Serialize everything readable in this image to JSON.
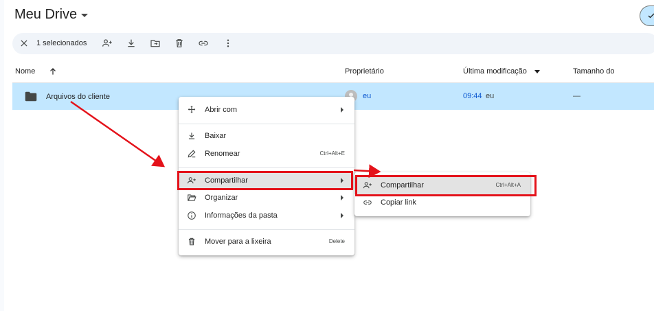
{
  "header": {
    "title": "Meu Drive"
  },
  "toolbar": {
    "selection_count": "1 selecionados"
  },
  "columns": {
    "name": "Nome",
    "owner": "Proprietário",
    "modified": "Última modificação",
    "size": "Tamanho do"
  },
  "file_row": {
    "name": "Arquivos do cliente",
    "owner": "eu",
    "modified": "09:44",
    "modified_by": "eu",
    "size": "—"
  },
  "context_menu": {
    "open_with": "Abrir com",
    "download": "Baixar",
    "rename": "Renomear",
    "rename_shortcut": "Ctrl+Alt+E",
    "share": "Compartilhar",
    "organize": "Organizar",
    "folder_info": "Informações da pasta",
    "trash": "Mover para a lixeira",
    "trash_shortcut": "Delete"
  },
  "share_submenu": {
    "share": "Compartilhar",
    "share_shortcut": "Ctrl+Alt+A",
    "copy_link": "Copiar link"
  },
  "colors": {
    "selected_row": "#c2e7ff",
    "toolbar_bg": "#f0f4f9",
    "annotation_red": "#e4121a",
    "hover_bg": "#e3e3e3",
    "link_blue": "#0b57d0"
  },
  "icons": [
    "close-icon",
    "add-person-icon",
    "download-icon",
    "move-folder-icon",
    "trash-icon",
    "link-icon",
    "more-vert-icon",
    "arrow-up-icon",
    "folder-icon",
    "open-with-icon",
    "rename-icon",
    "folder-open-icon",
    "info-icon",
    "check-icon"
  ]
}
